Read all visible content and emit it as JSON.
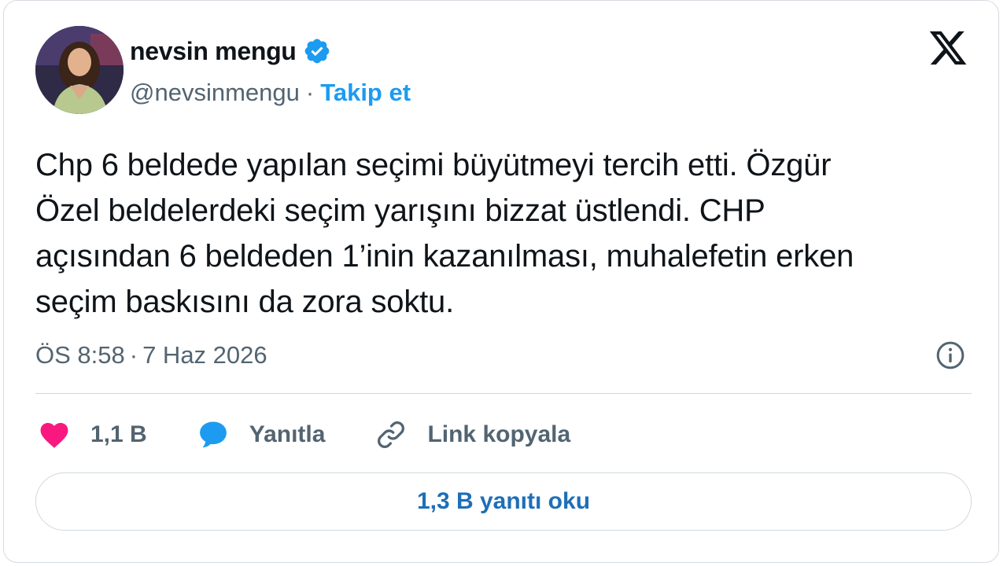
{
  "author": {
    "name": "nevsin mengu",
    "handle": "@nevsinmengu",
    "separator": "·",
    "follow_label": "Takip et",
    "verified_icon": "verified-badge-icon"
  },
  "tweet": {
    "text": "Chp 6 beldede yapılan seçimi büyütmeyi tercih etti. Özgür\nÖzel beldelerdeki seçim yarışını bizzat üstlendi. CHP\naçısından 6 beldeden 1’inin kazanılması, muhalefetin erken\nseçim baskısını da zora soktu.",
    "time": "ÖS 8:58",
    "separator": "·",
    "date": "7 Haz 2026"
  },
  "actions": {
    "like_count": "1,1 B",
    "reply_label": "Yanıtla",
    "copy_link_label": "Link kopyala"
  },
  "read_replies_label": "1,3 B yanıtı oku",
  "colors": {
    "accent": "#1d9bf0",
    "like": "#f91880",
    "reply_bubble": "#1d9bf0",
    "secondary_text": "#536471",
    "border": "#cfd9de"
  },
  "icons": [
    "avatar",
    "verified-badge-icon",
    "x-logo-icon",
    "info-icon",
    "heart-icon",
    "reply-bubble-icon",
    "link-icon"
  ]
}
